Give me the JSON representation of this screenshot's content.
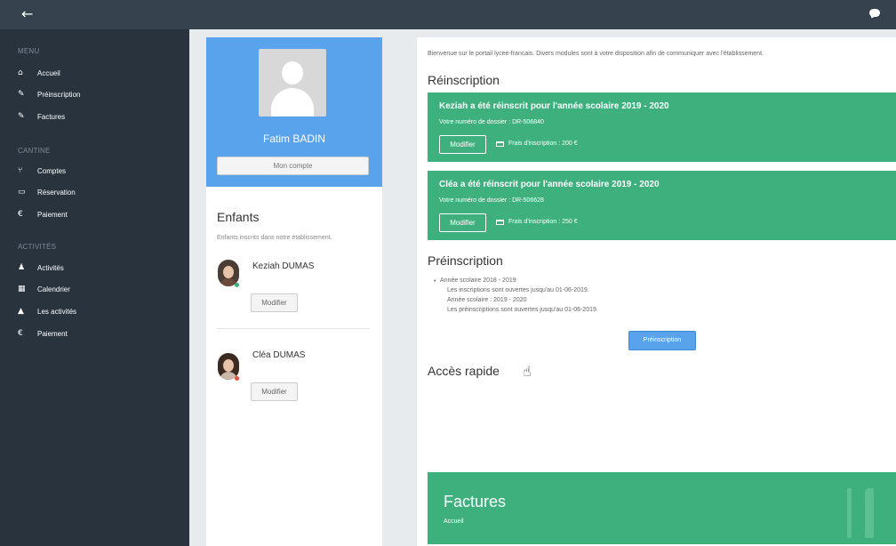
{
  "topbar": {
    "back_icon": "←",
    "chat_icon": "chat-bubble"
  },
  "sidebar": {
    "sections": [
      {
        "title": "MENU",
        "items": [
          {
            "icon": "⌂",
            "icon_name": "home-icon",
            "label": "Accueil"
          },
          {
            "icon": "✎",
            "icon_name": "pencil-icon",
            "label": "Préinscription"
          },
          {
            "icon": "✎",
            "icon_name": "pencil-icon",
            "label": "Factures"
          }
        ]
      },
      {
        "title": "CANTINE",
        "items": [
          {
            "icon": "⑂",
            "icon_name": "cutlery-icon",
            "label": "Comptes"
          },
          {
            "icon": "▭",
            "icon_name": "card-icon",
            "label": "Réservation"
          },
          {
            "icon": "€",
            "icon_name": "euro-icon",
            "label": "Paiement"
          }
        ]
      },
      {
        "title": "ACTIVITÉS",
        "items": [
          {
            "icon": "♟",
            "icon_name": "activity-icon",
            "label": "Activités"
          },
          {
            "icon": "▦",
            "icon_name": "calendar-icon",
            "label": "Calendrier"
          },
          {
            "icon": "▲",
            "icon_name": "activities-list-icon",
            "label": "Les activités"
          },
          {
            "icon": "€",
            "icon_name": "euro-icon",
            "label": "Paiement"
          }
        ]
      }
    ]
  },
  "profile": {
    "name": "Fatim BADIN",
    "account_button": "Mon compte"
  },
  "children": {
    "title": "Enfants",
    "subtitle": "Enfants inscrits dans notre établissement.",
    "list": [
      {
        "name": "Keziah DUMAS",
        "button": "Modifier",
        "status_color": "#3db07e"
      },
      {
        "name": "Cléa DUMAS",
        "button": "Modifier",
        "status_color": "#e74c3c"
      }
    ]
  },
  "main": {
    "welcome": "Bienvenue sur le portail lycee-francais. Divers modules sont à votre disposition afin de communiquer avec l'établissement.",
    "reinscription": {
      "title": "Réinscription",
      "cards": [
        {
          "title": "Keziah a été réinscrit pour l'année scolaire 2019 - 2020",
          "dossier": "Votre numéro de dossier : DR-506840",
          "button": "Modifier",
          "fee": "Frais d'inscription : 200 €"
        },
        {
          "title": "Cléa a été réinscrit pour l'année scolaire 2019 - 2020",
          "dossier": "Votre numéro de dossier : DR-506628",
          "button": "Modifier",
          "fee": "Frais d'inscription : 250 €"
        }
      ]
    },
    "preinscription": {
      "title": "Préinscription",
      "lines": [
        "Année scolaire 2018 - 2019",
        "Les inscriptions sont ouvertes jusqu'au 01-06-2019.",
        "Année scolaire : 2019 - 2020",
        "Les préinscriptions sont ouvertes jusqu'au 01-06-2019."
      ],
      "button": "Préinscription"
    },
    "quick_access": {
      "title": "Accès rapide"
    },
    "tile": {
      "title": "Factures",
      "subtitle": "Accueil"
    }
  },
  "colors": {
    "topbar": "#36434f",
    "sidebar": "#28333e",
    "accent_blue": "#58a3ec",
    "accent_green": "#3db07e"
  }
}
